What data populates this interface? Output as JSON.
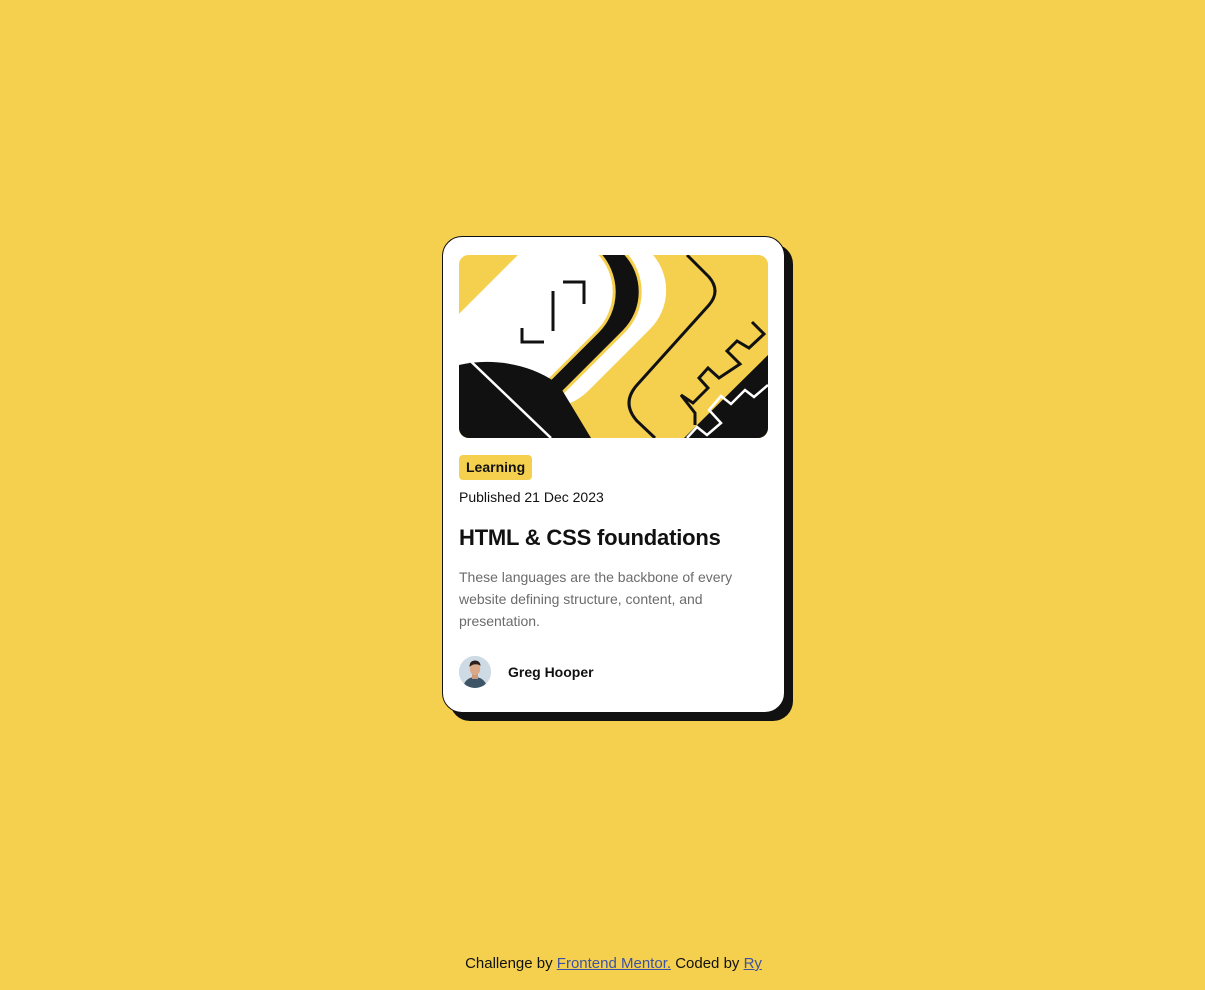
{
  "card": {
    "tag": "Learning",
    "published": "Published 21 Dec 2023",
    "title": "HTML & CSS foundations",
    "description": "These languages are the backbone of every website defining structure, content, and presentation.",
    "author": {
      "name": "Greg Hooper",
      "avatar_icon": "person-avatar"
    },
    "illustration_icon": "abstract-illustration"
  },
  "footer": {
    "text_1": "Challenge by ",
    "link_1": "Frontend Mentor.",
    "text_2": " Coded by ",
    "link_2": "Ry"
  },
  "colors": {
    "background": "#f4d04e",
    "card": "#ffffff",
    "ink": "#111111",
    "muted": "#6b6b6b",
    "link": "#3e52a3"
  }
}
